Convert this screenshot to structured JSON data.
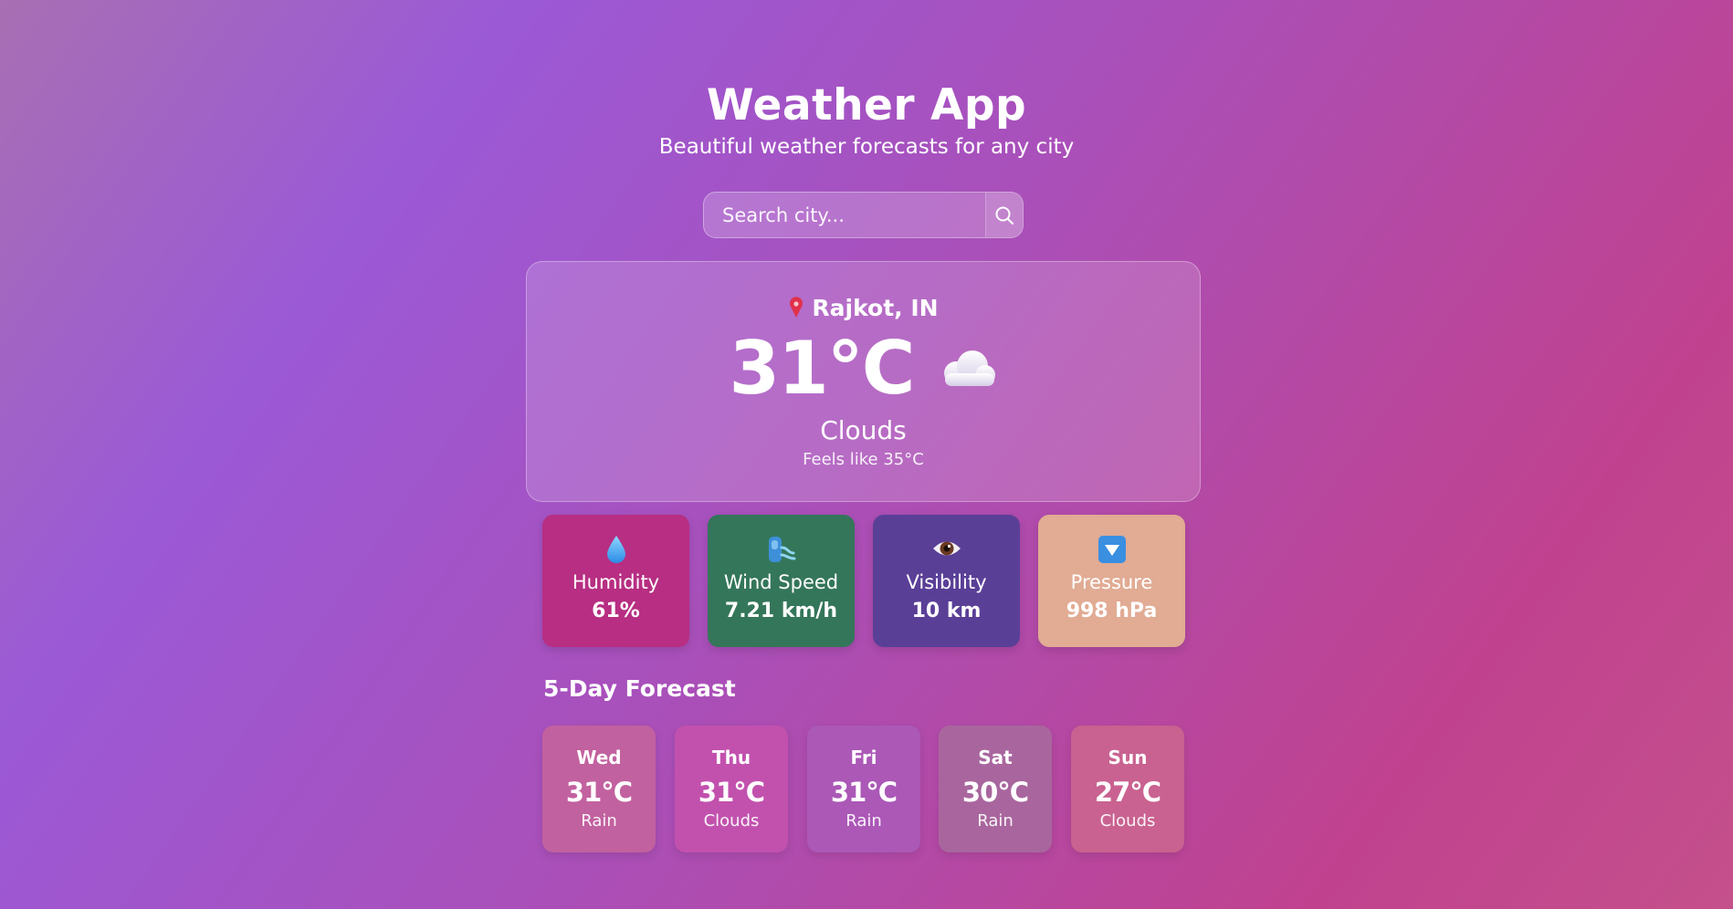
{
  "header": {
    "title": "Weather App",
    "subtitle": "Beautiful weather forecasts for any city"
  },
  "search": {
    "placeholder": "Search city...",
    "value": "",
    "icon": "search-icon"
  },
  "current": {
    "location": "Rajkot, IN",
    "location_icon": "pin-icon",
    "temperature": "31°C",
    "weather_icon": "cloud-icon",
    "condition": "Clouds",
    "feels_like": "Feels like 35°C"
  },
  "stats": [
    {
      "label": "Humidity",
      "value": "61%",
      "icon": "droplet-icon",
      "color": "#b72e82"
    },
    {
      "label": "Wind Speed",
      "value": "7.21 km/h",
      "icon": "wind-icon",
      "color": "#34765a"
    },
    {
      "label": "Visibility",
      "value": "10 km",
      "icon": "eye-icon",
      "color": "#5a3f97"
    },
    {
      "label": "Pressure",
      "value": "998 hPa",
      "icon": "down-arrow-icon",
      "color": "#e1ab94"
    }
  ],
  "forecast": {
    "title": "5-Day Forecast",
    "days": [
      {
        "day": "Wed",
        "temp": "31°C",
        "condition": "Rain",
        "color": "#c2619f"
      },
      {
        "day": "Thu",
        "temp": "31°C",
        "condition": "Clouds",
        "color": "#c251ae"
      },
      {
        "day": "Fri",
        "temp": "31°C",
        "condition": "Rain",
        "color": "#ab58b7"
      },
      {
        "day": "Sat",
        "temp": "30°C",
        "condition": "Rain",
        "color": "#a9669e"
      },
      {
        "day": "Sun",
        "temp": "27°C",
        "condition": "Clouds",
        "color": "#c96290"
      }
    ]
  }
}
